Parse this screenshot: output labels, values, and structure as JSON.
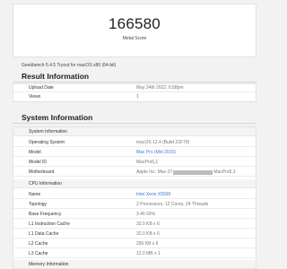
{
  "score": {
    "value": "166580",
    "label": "Metal Score"
  },
  "version_line": "Geekbench 5.4.5 Tryout for macOS x86 (64-bit)",
  "result": {
    "title": "Result Information",
    "rows": [
      {
        "key": "Upload Date",
        "value": "May 24th 2022, 6:58pm"
      },
      {
        "key": "Views",
        "value": "1"
      }
    ]
  },
  "system": {
    "title": "System Information",
    "groups": [
      {
        "name": "System Information",
        "rows": [
          {
            "key": "Operating System",
            "value": "macOS 12.4 (Build 21F79)"
          },
          {
            "key": "Model",
            "value": "Mac Pro (Mid 2010)"
          },
          {
            "key": "Model ID",
            "value": "MacPro5,1"
          },
          {
            "key": "Motherboard",
            "value_prefix": "Apple Inc. Mac-27",
            "value_suffix": "MacPro5,1"
          }
        ]
      },
      {
        "name": "CPU Information",
        "rows": [
          {
            "key": "Name",
            "value": "Intel Xeon X5690"
          },
          {
            "key": "Topology",
            "value": "2 Processors, 12 Cores, 24 Threads"
          },
          {
            "key": "Base Frequency",
            "value": "3.46 GHz"
          },
          {
            "key": "L1 Instruction Cache",
            "value": "32.0 KB x 6"
          },
          {
            "key": "L1 Data Cache",
            "value": "32.0 KB x 6"
          },
          {
            "key": "L2 Cache",
            "value": "256 KB x 6"
          },
          {
            "key": "L3 Cache",
            "value": "12.0 MB x 1"
          }
        ]
      },
      {
        "name": "Memory Information"
      }
    ]
  },
  "colors": {
    "link": "#3b7bd0",
    "page_bg": "#f2f2f2"
  }
}
